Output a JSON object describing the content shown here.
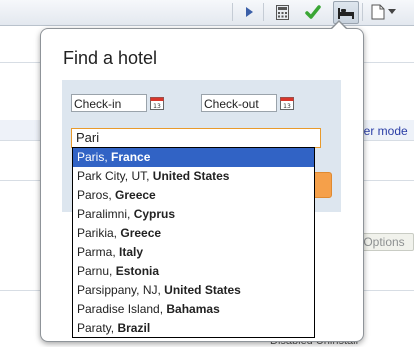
{
  "toolbar": {
    "icons": [
      "play-icon",
      "calculator-icon",
      "checkmark-icon",
      "hotel-bed-icon",
      "page-icon",
      "chevron-down-icon"
    ]
  },
  "background": {
    "link_text": "per mode",
    "options_label": "Options",
    "bottom_text": "Disabled  Uninstall"
  },
  "popup": {
    "title": "Find a hotel",
    "checkin_placeholder": "Check-in",
    "checkout_placeholder": "Check-out",
    "search_value": "Pari"
  },
  "suggestions": [
    {
      "place": "Paris, ",
      "country": "France"
    },
    {
      "place": "Park City, UT, ",
      "country": "United States"
    },
    {
      "place": "Paros, ",
      "country": "Greece"
    },
    {
      "place": "Paralimni, ",
      "country": "Cyprus"
    },
    {
      "place": "Parikia, ",
      "country": "Greece"
    },
    {
      "place": "Parma, ",
      "country": "Italy"
    },
    {
      "place": "Parnu, ",
      "country": "Estonia"
    },
    {
      "place": "Parsippany, NJ, ",
      "country": "United States"
    },
    {
      "place": "Paradise Island, ",
      "country": "Bahamas"
    },
    {
      "place": "Paraty, ",
      "country": "Brazil"
    }
  ],
  "colors": {
    "selected": "#3163c5",
    "accent_orange": "#f5a04a",
    "panel": "#dde6ef"
  }
}
